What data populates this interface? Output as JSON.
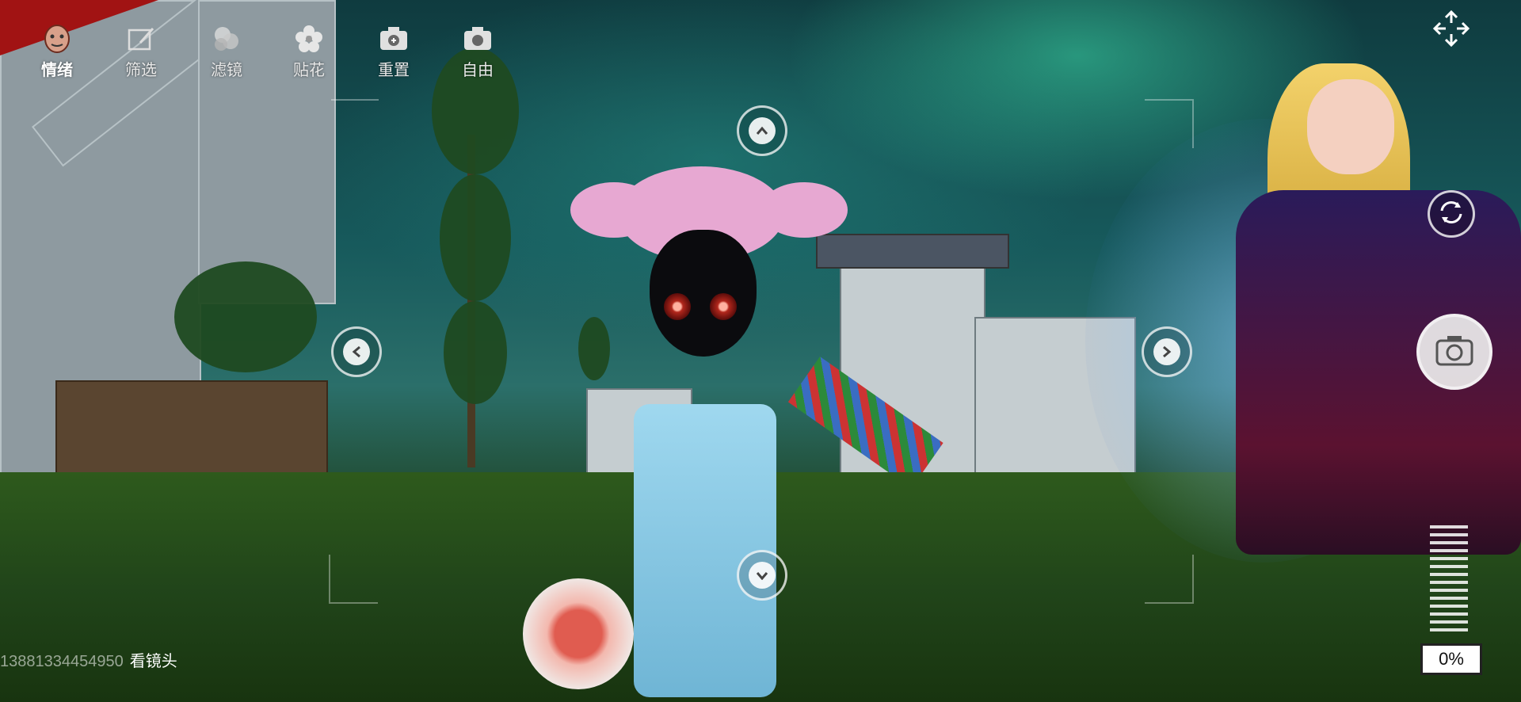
{
  "toolbar": {
    "items": [
      {
        "label": "情绪",
        "icon": "face-icon",
        "active": true
      },
      {
        "label": "筛选",
        "icon": "filter-edit-icon",
        "active": false
      },
      {
        "label": "滤镜",
        "icon": "filter-circles-icon",
        "active": false
      },
      {
        "label": "贴花",
        "icon": "flower-sticker-icon",
        "active": false
      },
      {
        "label": "重置",
        "icon": "camera-reset-icon",
        "active": false
      },
      {
        "label": "自由",
        "icon": "camera-free-icon",
        "active": false
      }
    ]
  },
  "camera_controls": {
    "up": "up-arrow-icon",
    "down": "down-arrow-icon",
    "left": "left-arrow-icon",
    "right": "right-arrow-icon"
  },
  "side_controls": {
    "expand": "expand-icon",
    "rotate": "rotate-icon",
    "shutter": "camera-shutter-icon"
  },
  "zoom": {
    "value_label": "0%",
    "level": 0
  },
  "caption": {
    "user_id": "13881334454950",
    "action": "看镜头"
  },
  "colors": {
    "accent_red": "#a11313",
    "overlay_white": "#ffffff"
  }
}
